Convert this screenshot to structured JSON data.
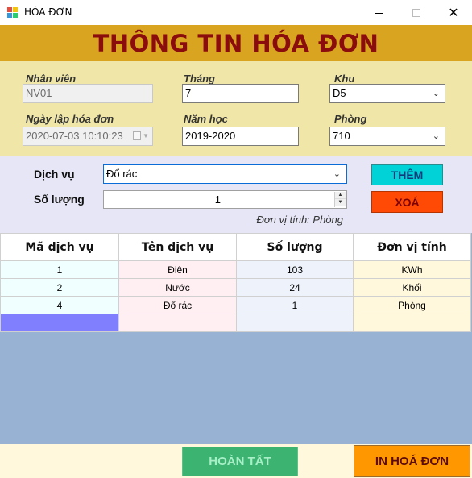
{
  "window": {
    "title": "HÓA ĐƠN",
    "controls": {
      "minimize": "—",
      "maximize": "☐",
      "close": "✕"
    }
  },
  "header": {
    "title": "THÔNG TIN HÓA ĐƠN"
  },
  "info": {
    "employee": {
      "label": "Nhân viên",
      "value": "NV01"
    },
    "month": {
      "label": "Tháng",
      "value": "7"
    },
    "area": {
      "label": "Khu",
      "value": "D5"
    },
    "invoice_date": {
      "label": "Ngày lập hóa đơn",
      "value": "2020-07-03 10:10:23"
    },
    "school_year": {
      "label": "Năm học",
      "value": "2019-2020"
    },
    "room": {
      "label": "Phòng",
      "value": "710"
    }
  },
  "service": {
    "service_label": "Dịch vụ",
    "service_value": "Đổ rác",
    "quantity_label": "Số lượng",
    "quantity_value": "1",
    "unit_note": "Đơn vị tính: Phòng",
    "add_label": "THÊM",
    "delete_label": "XOÁ"
  },
  "table": {
    "headers": [
      "Mã dịch vụ",
      "Tên dịch vụ",
      "Số lượng",
      "Đơn vị tính"
    ],
    "rows": [
      [
        "1",
        "Điên",
        "103",
        "KWh"
      ],
      [
        "2",
        "Nước",
        "24",
        "Khối"
      ],
      [
        "4",
        "Đổ rác",
        "1",
        "Phòng"
      ]
    ]
  },
  "footer": {
    "finish_label": "HOÀN TẤT",
    "print_label": "IN HOÁ ĐƠN"
  },
  "colors": {
    "header_bg": "#d9a521",
    "header_text": "#8b0c0c",
    "info_bg": "#efe6a8",
    "service_bg": "#e6e6f7",
    "add_button": "#00d2d8",
    "delete_button": "#ff4a06",
    "grid_bg": "#97b2d2",
    "finish_button": "#3cb371",
    "print_button": "#ff9800"
  }
}
